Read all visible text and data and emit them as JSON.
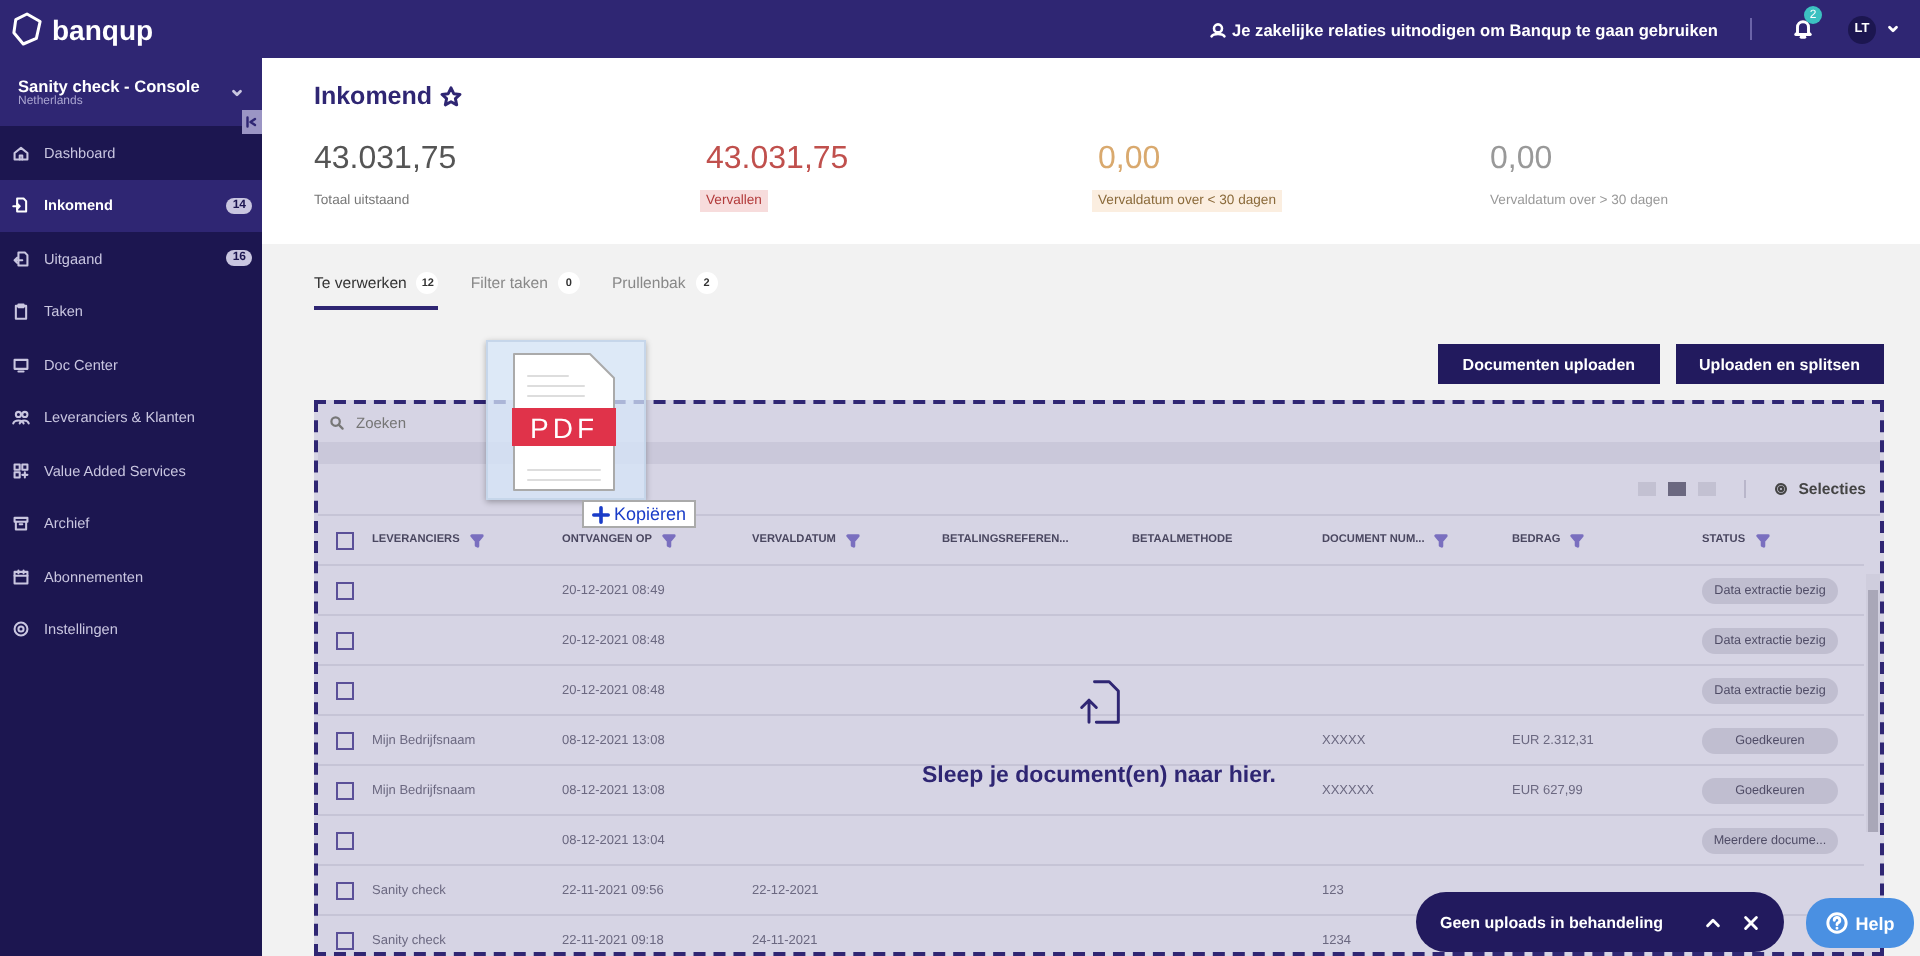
{
  "topbar": {
    "logo": "banqup",
    "invite": "Je zakelijke relaties uitnodigen om Banqup te gaan gebruiken",
    "notifications": "2",
    "user": "LT"
  },
  "sidebar": {
    "org": "Sanity check - Console",
    "country": "Netherlands",
    "items": [
      {
        "label": "Dashboard",
        "selected": false
      },
      {
        "label": "Inkomend",
        "badge": "14",
        "selected": true
      },
      {
        "label": "Uitgaand",
        "badge": "16",
        "selected": false
      },
      {
        "label": "Taken",
        "selected": false
      },
      {
        "label": "Doc Center",
        "selected": false
      },
      {
        "label": "Leveranciers & Klanten",
        "selected": false
      },
      {
        "label": "Value Added Services",
        "selected": false
      },
      {
        "label": "Archief",
        "selected": false
      },
      {
        "label": "Abonnementen",
        "selected": false
      },
      {
        "label": "Instellingen",
        "selected": false
      }
    ]
  },
  "page": {
    "title": "Inkomend",
    "starred": false
  },
  "stats": [
    {
      "value": "43.031,75",
      "label": "Totaal uitstaand",
      "kind": "neutral"
    },
    {
      "value": "43.031,75",
      "label": "Vervallen",
      "kind": "danger"
    },
    {
      "value": "0,00",
      "label": "Vervaldatum over < 30 dagen",
      "kind": "warning"
    },
    {
      "value": "0,00",
      "label": "Vervaldatum over > 30 dagen",
      "kind": "muted"
    }
  ],
  "tabs": [
    {
      "label": "Te verwerken",
      "count": "12",
      "selected": true
    },
    {
      "label": "Filter taken",
      "count": "0",
      "selected": false
    },
    {
      "label": "Prullenbak",
      "count": "2",
      "selected": false
    }
  ],
  "buttons": [
    "Documenten uploaden",
    "Uploaden en splitsen"
  ],
  "search": {
    "placeholder": "Zoeken"
  },
  "view_modes": [
    {
      "selected": false
    },
    {
      "selected": true
    },
    {
      "selected": false
    }
  ],
  "selections": "Selecties",
  "table": {
    "columns": [
      {
        "label": "LEVERANCIERS",
        "filter": true
      },
      {
        "label": "ONTVANGEN OP",
        "filter": true
      },
      {
        "label": "VERVALDATUM",
        "filter": true
      },
      {
        "label": "BETALINGSREFEREN...",
        "filter": false
      },
      {
        "label": "BETAALMETHODE",
        "filter": false
      },
      {
        "label": "DOCUMENT NUM...",
        "filter": true
      },
      {
        "label": "BEDRAG",
        "filter": true
      },
      {
        "label": "STATUS",
        "filter": true
      }
    ],
    "header_checked": false,
    "rows": [
      {
        "checked": false,
        "received_on": "20-12-2021 08:49",
        "status": {
          "label": "Data extractie bezig",
          "kind": "neutral"
        }
      },
      {
        "checked": false,
        "received_on": "20-12-2021 08:48",
        "status": {
          "label": "Data extractie bezig",
          "kind": "neutral"
        }
      },
      {
        "checked": false,
        "received_on": "20-12-2021 08:48",
        "status": {
          "label": "Data extractie bezig",
          "kind": "neutral"
        }
      },
      {
        "checked": false,
        "supplier": "Mijn Bedrijfsnaam",
        "received_on": "08-12-2021 13:08",
        "document_number": "XXXXX",
        "amount": "EUR 2.312,31",
        "status": {
          "label": "Goedkeuren",
          "kind": "neutral"
        }
      },
      {
        "checked": false,
        "supplier": "Mijn Bedrijfsnaam",
        "received_on": "08-12-2021 13:08",
        "document_number": "XXXXXX",
        "amount": "EUR 627,99",
        "status": {
          "label": "Goedkeuren",
          "kind": "neutral"
        }
      },
      {
        "checked": false,
        "received_on": "08-12-2021 13:04",
        "status": {
          "label": "Meerdere docume...",
          "kind": "neutral"
        }
      },
      {
        "checked": false,
        "supplier": "Sanity check",
        "received_on": "22-11-2021 09:56",
        "due_date": "22-12-2021",
        "document_number": "123"
      },
      {
        "checked": false,
        "supplier": "Sanity check",
        "received_on": "22-11-2021 09:18",
        "due_date": "24-11-2021",
        "document_number": "1234"
      }
    ]
  },
  "drop_zone": {
    "message": "Sleep je document(en) naar hier."
  },
  "drag_ghost": {
    "file_label": "PDF",
    "action": "Kopiëren"
  },
  "uploads_toast": {
    "text": "Geen uploads in behandeling"
  },
  "help": "Help"
}
